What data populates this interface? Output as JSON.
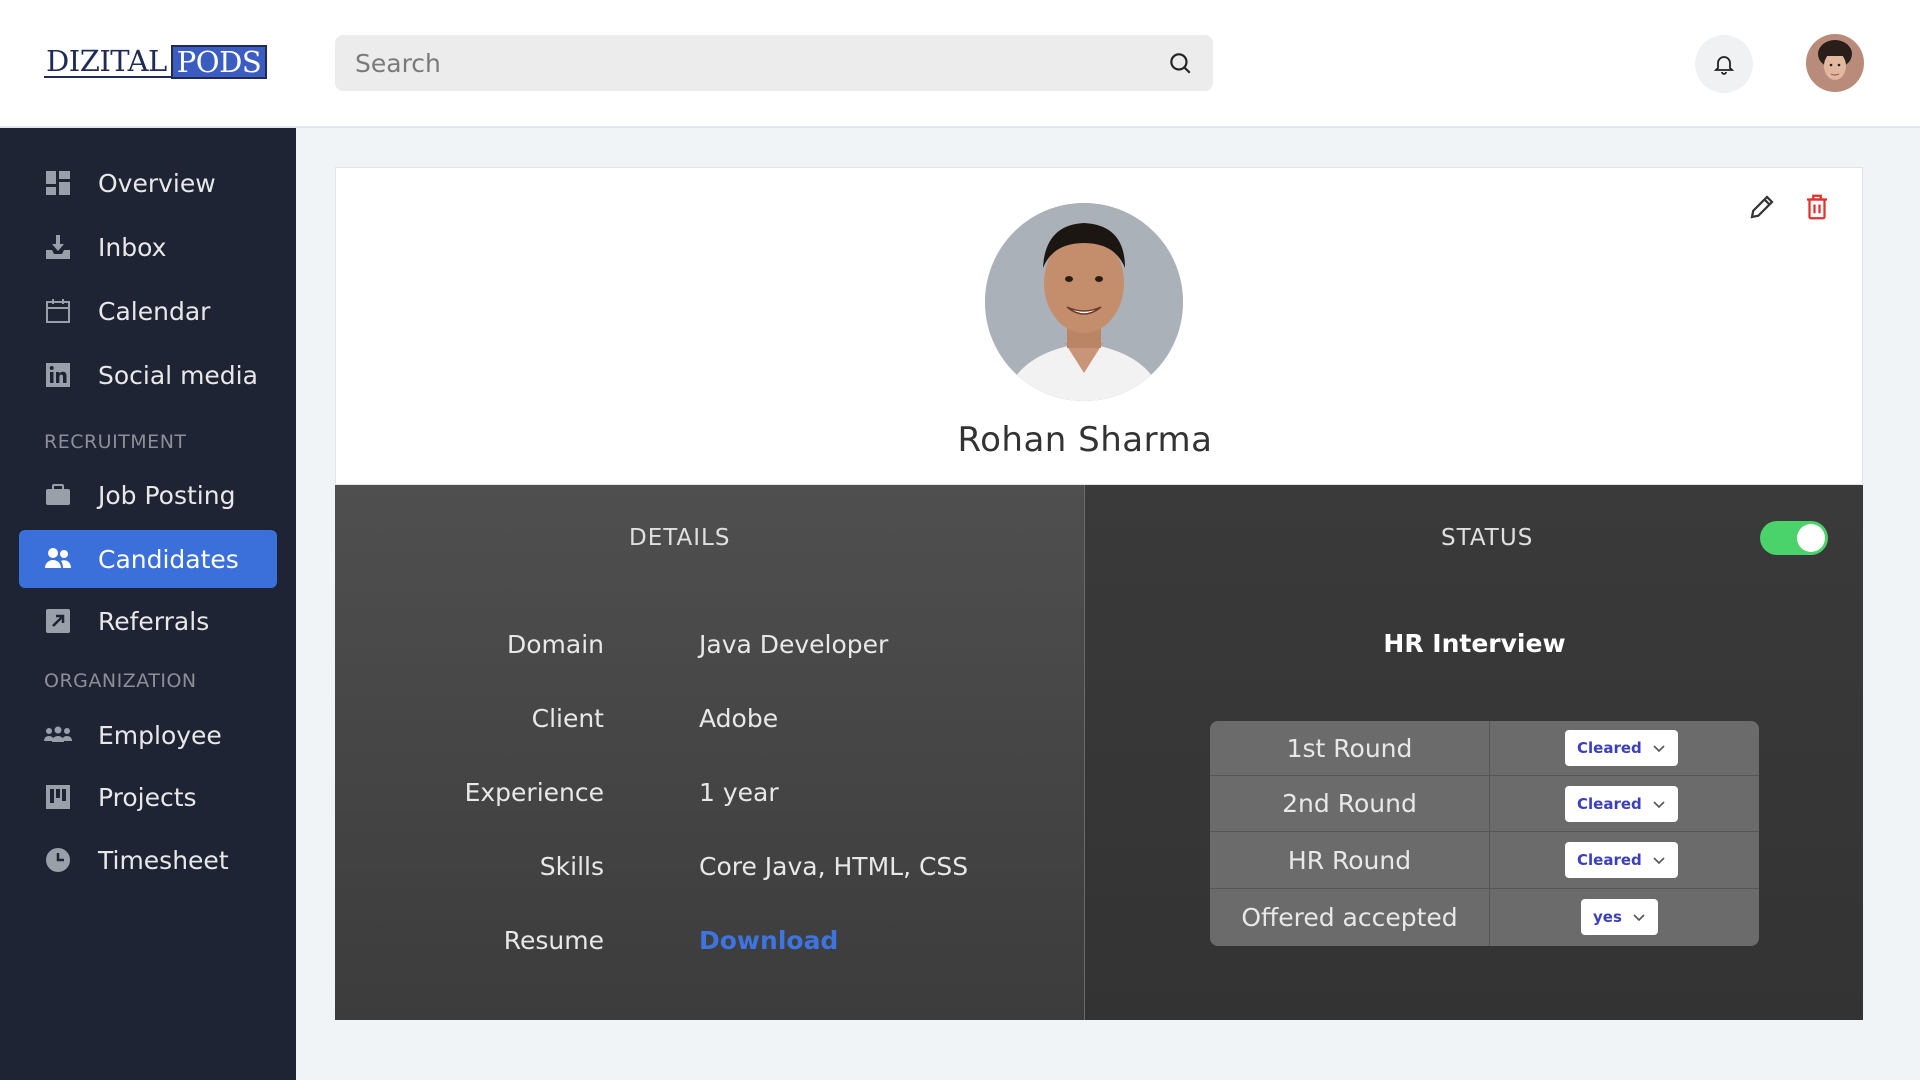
{
  "header": {
    "logo_part1": "DIZITAL",
    "logo_part2": "PODS",
    "search_placeholder": "Search"
  },
  "sidebar": {
    "items": [
      {
        "label": "Overview",
        "icon": "dashboard-icon"
      },
      {
        "label": "Inbox",
        "icon": "inbox-download-icon"
      },
      {
        "label": "Calendar",
        "icon": "calendar-icon"
      },
      {
        "label": "Social media",
        "icon": "linkedin-icon"
      }
    ],
    "section_recruitment": "RECRUITMENT",
    "recruitment_items": [
      {
        "label": "Job Posting",
        "icon": "briefcase-icon"
      },
      {
        "label": "Candidates",
        "icon": "users-icon",
        "active": true
      },
      {
        "label": "Referrals",
        "icon": "external-link-icon"
      }
    ],
    "section_organization": "ORGANIZATION",
    "organization_items": [
      {
        "label": "Employee",
        "icon": "group-icon"
      },
      {
        "label": "Projects",
        "icon": "kanban-icon"
      },
      {
        "label": "Timesheet",
        "icon": "clock-icon"
      }
    ],
    "active_color": "#3b6fd9",
    "background": "#1e2433"
  },
  "profile": {
    "name": "Rohan Sharma"
  },
  "details": {
    "title": "DETAILS",
    "rows": [
      {
        "key": "Domain",
        "value": "Java Developer"
      },
      {
        "key": "Client",
        "value": "Adobe"
      },
      {
        "key": "Experience",
        "value": "1 year"
      },
      {
        "key": "Skills",
        "value": "Core Java, HTML, CSS"
      },
      {
        "key": "Resume",
        "value": "Download"
      }
    ]
  },
  "status": {
    "title": "STATUS",
    "toggle_on": true,
    "stage": "HR Interview",
    "rounds": [
      {
        "label": "1st Round",
        "value": "Cleared"
      },
      {
        "label": "2nd Round",
        "value": "Cleared"
      },
      {
        "label": "HR Round",
        "value": "Cleared"
      },
      {
        "label": "Offered accepted",
        "value": "yes"
      }
    ]
  }
}
